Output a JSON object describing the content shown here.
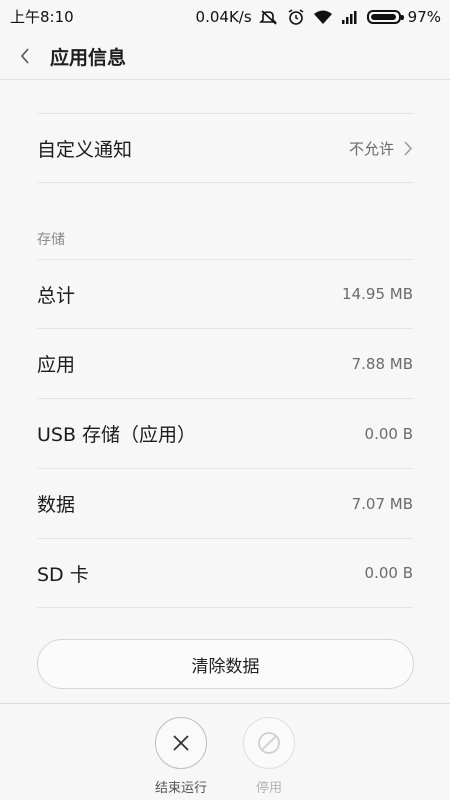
{
  "status_bar": {
    "time": "上午8:10",
    "network_speed": "0.04K/s",
    "battery_percent": "97%",
    "battery_level": 0.97,
    "icons": [
      "mute-icon",
      "alarm-icon",
      "wifi-icon",
      "signal-icon",
      "battery-icon"
    ]
  },
  "header": {
    "title": "应用信息",
    "back_icon": "chevron-left-icon"
  },
  "notification": {
    "label": "自定义通知",
    "value": "不允许"
  },
  "storage": {
    "section_label": "存储",
    "rows": [
      {
        "label": "总计",
        "value": "14.95 MB"
      },
      {
        "label": "应用",
        "value": "7.88 MB"
      },
      {
        "label": "USB 存储（应用）",
        "value": "0.00 B"
      },
      {
        "label": "数据",
        "value": "7.07 MB"
      },
      {
        "label": "SD 卡",
        "value": "0.00 B"
      }
    ]
  },
  "clear_data_label": "清除数据",
  "bottom_actions": {
    "force_stop_label": "结束运行",
    "disable_label": "停用"
  },
  "colors": {
    "background": "#f7f7f7",
    "separator": "#e4e4e4",
    "text_primary": "#1c1c1c",
    "text_secondary": "#6b6b6b",
    "disabled": "#b5b5b5"
  }
}
